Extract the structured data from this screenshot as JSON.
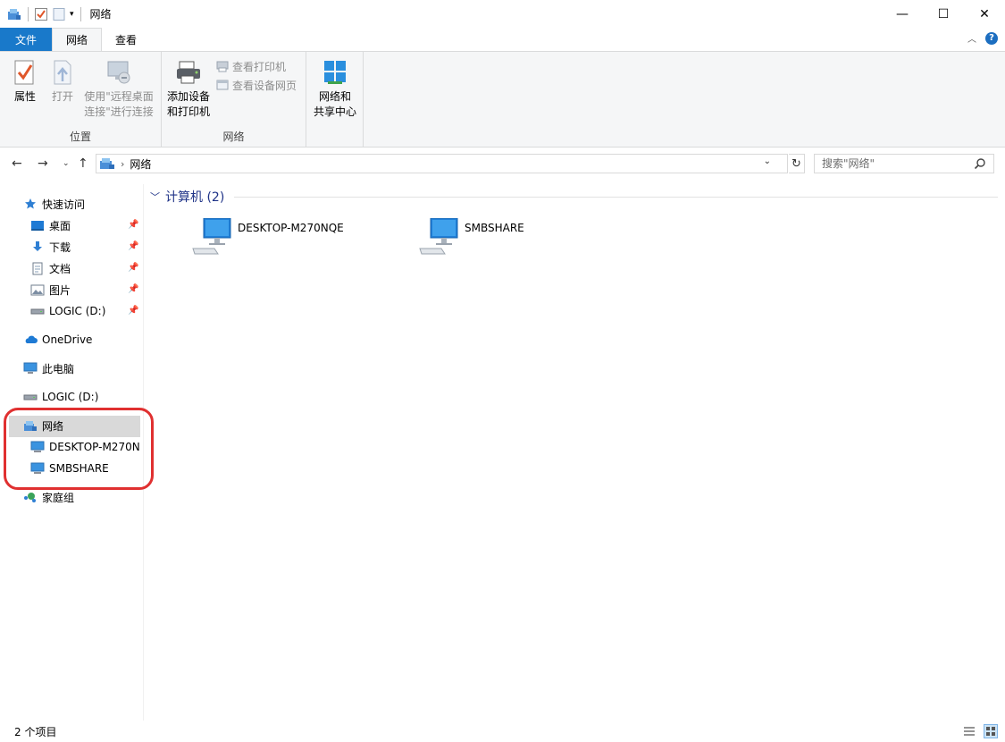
{
  "window": {
    "title": "网络",
    "minimize": "—",
    "maximize": "☐",
    "close": "✕"
  },
  "tabs": [
    {
      "label": "文件"
    },
    {
      "label": "网络"
    },
    {
      "label": "查看"
    }
  ],
  "ribbon": {
    "location_group": {
      "label": "位置",
      "properties": "属性",
      "open": "打开",
      "remote_line1": "使用\"远程桌面",
      "remote_line2": "连接\"进行连接"
    },
    "network_group": {
      "label": "网络",
      "add_line1": "添加设备",
      "add_line2": "和打印机",
      "view_printers": "查看打印机",
      "view_device_webpage": "查看设备网页"
    },
    "sharing": {
      "line1": "网络和",
      "line2": "共享中心"
    }
  },
  "address": {
    "path": "网络",
    "search_placeholder": "搜索\"网络\""
  },
  "navpane": {
    "quick_access": "快速访问",
    "quick_items": [
      "桌面",
      "下载",
      "文档",
      "图片",
      "LOGIC (D:)"
    ],
    "onedrive": "OneDrive",
    "this_pc": "此电脑",
    "drive": "LOGIC (D:)",
    "network": "网络",
    "network_children": [
      "DESKTOP-M270N",
      "SMBSHARE"
    ],
    "homegroup": "家庭组"
  },
  "content": {
    "group_title": "计算机 (2)",
    "computers": [
      "DESKTOP-M270NQE",
      "SMBSHARE"
    ]
  },
  "status": {
    "items": "2 个项目"
  },
  "colors": {
    "file_tab": "#1979ca",
    "accent": "#1e3287",
    "selection": "#d9d9d9",
    "ring": "#e03030"
  }
}
